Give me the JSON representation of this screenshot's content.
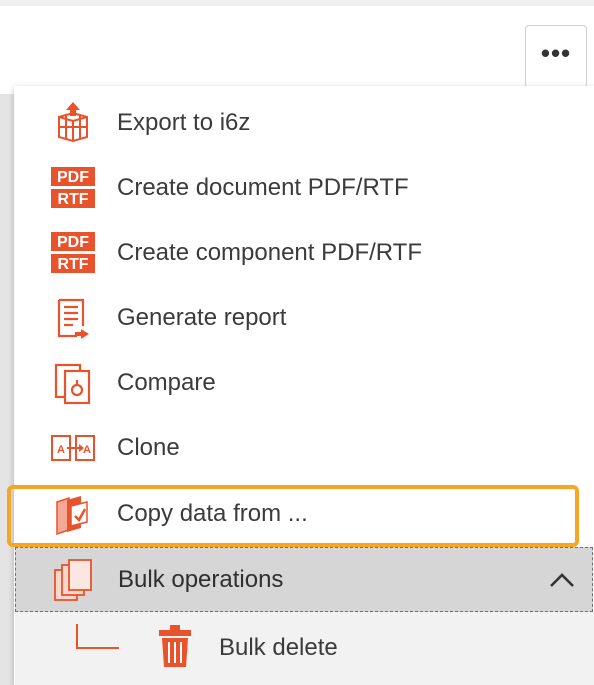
{
  "toolbar": {
    "more_label": "•••"
  },
  "menu": {
    "items": [
      {
        "label": "Export to i6z",
        "icon": "export-cube-icon"
      },
      {
        "label": "Create document PDF/RTF",
        "icon": "pdf-rtf-icon"
      },
      {
        "label": "Create component PDF/RTF",
        "icon": "pdf-rtf-icon"
      },
      {
        "label": "Generate report",
        "icon": "report-icon"
      },
      {
        "label": "Compare",
        "icon": "compare-icon"
      },
      {
        "label": "Clone",
        "icon": "clone-icon"
      },
      {
        "label": "Copy data from ...",
        "icon": "copy-data-icon"
      }
    ],
    "bulk": {
      "label": "Bulk operations",
      "icon": "bulk-docs-icon",
      "expanded": true,
      "children": [
        {
          "label": "Bulk delete",
          "icon": "trash-icon"
        }
      ]
    },
    "pdf_badge_top": "PDF",
    "pdf_badge_bottom": "RTF",
    "clone_glyph_left": "A",
    "clone_glyph_right": "A"
  },
  "colors": {
    "accent": "#e8532b",
    "highlight": "#f5a623",
    "text": "#3b3b3b"
  }
}
